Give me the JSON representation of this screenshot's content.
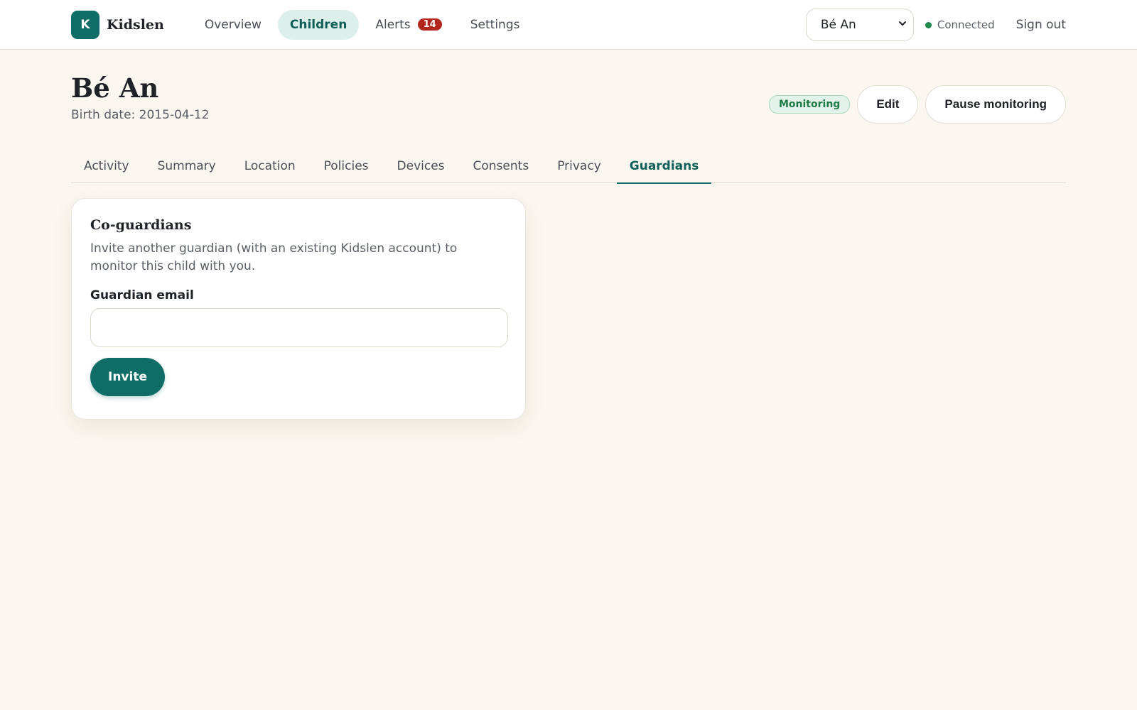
{
  "brand": {
    "initial": "K",
    "name": "Kidslen"
  },
  "nav": {
    "overview": "Overview",
    "children": "Children",
    "alerts": "Alerts",
    "alerts_count": "14",
    "settings": "Settings"
  },
  "topbar": {
    "selected_child": "Bé An",
    "status_text": "Connected",
    "sign_out": "Sign out"
  },
  "child": {
    "name": "Bé An",
    "birth_date": "Birth date: 2015-04-12",
    "status_badge": "Monitoring",
    "edit_label": "Edit",
    "pause_label": "Pause monitoring"
  },
  "tabs": [
    {
      "label": "Activity"
    },
    {
      "label": "Summary"
    },
    {
      "label": "Location"
    },
    {
      "label": "Policies"
    },
    {
      "label": "Devices"
    },
    {
      "label": "Consents"
    },
    {
      "label": "Privacy"
    },
    {
      "label": "Guardians"
    }
  ],
  "active_tab": "Guardians",
  "card": {
    "title": "Co-guardians",
    "description": "Invite another guardian (with an existing Kidslen account) to monitor this child with you.",
    "email_label": "Guardian email",
    "email_value": "",
    "invite_label": "Invite"
  },
  "colors": {
    "accent": "#106c66",
    "background": "#faf7f0",
    "alert_badge": "#b3261e",
    "status_ok": "#1e8a4c"
  }
}
